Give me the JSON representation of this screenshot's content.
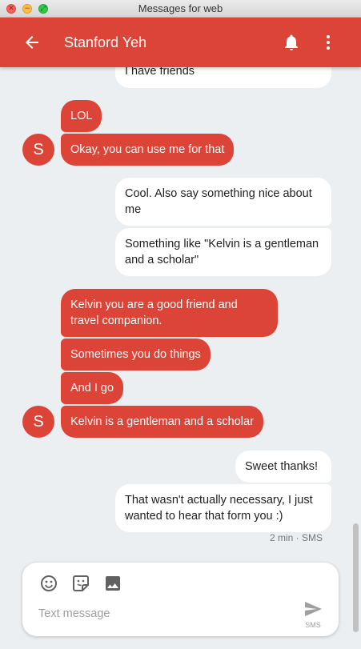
{
  "window": {
    "title": "Messages for web"
  },
  "header": {
    "contact_name": "Stanford Yeh",
    "accent_color": "#db4437",
    "icons": [
      "back-arrow-icon",
      "bell-icon",
      "more-vert-icon"
    ]
  },
  "messages": [
    {
      "direction": "outgoing",
      "text": "I have friends"
    },
    {
      "direction": "incoming",
      "text": "LOL"
    },
    {
      "direction": "incoming",
      "text": "Okay, you can use me for that",
      "avatar": "S"
    },
    {
      "direction": "outgoing",
      "text": "Cool. Also say something nice about me"
    },
    {
      "direction": "outgoing",
      "text": "Something like \"Kelvin is a gentleman and a scholar\""
    },
    {
      "direction": "incoming",
      "text": "Kelvin you are a good friend and travel companion."
    },
    {
      "direction": "incoming",
      "text": "Sometimes you do things"
    },
    {
      "direction": "incoming",
      "text": "And I go"
    },
    {
      "direction": "incoming",
      "text": "Kelvin is a gentleman and a scholar",
      "avatar": "S"
    },
    {
      "direction": "outgoing",
      "text": "Sweet thanks!"
    },
    {
      "direction": "outgoing",
      "text": "That wasn't actually necessary, I just wanted to hear that form you :)"
    }
  ],
  "last_status": "2 min · SMS",
  "compose": {
    "placeholder": "Text message",
    "send_label": "SMS",
    "icons": [
      "emoji-icon",
      "sticker-icon",
      "image-icon",
      "send-icon"
    ]
  }
}
